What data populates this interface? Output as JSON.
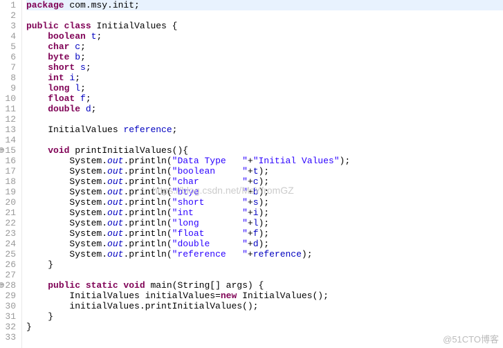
{
  "watermark_center": "https://blog.csdn.net/MsYfromGZ",
  "watermark_corner": "@51CTO博客",
  "code": {
    "lines": [
      {
        "n": 1,
        "marker": false,
        "hl": true,
        "tokens": [
          {
            "t": "kw",
            "v": "package"
          },
          {
            "t": "plain",
            "v": " com.msy.init;"
          }
        ]
      },
      {
        "n": 2,
        "marker": false,
        "tokens": []
      },
      {
        "n": 3,
        "marker": false,
        "tokens": [
          {
            "t": "kw",
            "v": "public class"
          },
          {
            "t": "plain",
            "v": " InitialValues {"
          }
        ]
      },
      {
        "n": 4,
        "marker": false,
        "tokens": [
          {
            "t": "plain",
            "v": "    "
          },
          {
            "t": "kw",
            "v": "boolean"
          },
          {
            "t": "plain",
            "v": " "
          },
          {
            "t": "fld",
            "v": "t"
          },
          {
            "t": "plain",
            "v": ";"
          }
        ]
      },
      {
        "n": 5,
        "marker": false,
        "tokens": [
          {
            "t": "plain",
            "v": "    "
          },
          {
            "t": "kw",
            "v": "char"
          },
          {
            "t": "plain",
            "v": " "
          },
          {
            "t": "fld",
            "v": "c"
          },
          {
            "t": "plain",
            "v": ";"
          }
        ]
      },
      {
        "n": 6,
        "marker": false,
        "tokens": [
          {
            "t": "plain",
            "v": "    "
          },
          {
            "t": "kw",
            "v": "byte"
          },
          {
            "t": "plain",
            "v": " "
          },
          {
            "t": "fld",
            "v": "b"
          },
          {
            "t": "plain",
            "v": ";"
          }
        ]
      },
      {
        "n": 7,
        "marker": false,
        "tokens": [
          {
            "t": "plain",
            "v": "    "
          },
          {
            "t": "kw",
            "v": "short"
          },
          {
            "t": "plain",
            "v": " "
          },
          {
            "t": "fld",
            "v": "s"
          },
          {
            "t": "plain",
            "v": ";"
          }
        ]
      },
      {
        "n": 8,
        "marker": false,
        "tokens": [
          {
            "t": "plain",
            "v": "    "
          },
          {
            "t": "kw",
            "v": "int"
          },
          {
            "t": "plain",
            "v": " "
          },
          {
            "t": "fld",
            "v": "i"
          },
          {
            "t": "plain",
            "v": ";"
          }
        ]
      },
      {
        "n": 9,
        "marker": false,
        "tokens": [
          {
            "t": "plain",
            "v": "    "
          },
          {
            "t": "kw",
            "v": "long"
          },
          {
            "t": "plain",
            "v": " "
          },
          {
            "t": "fld",
            "v": "l"
          },
          {
            "t": "plain",
            "v": ";"
          }
        ]
      },
      {
        "n": 10,
        "marker": false,
        "tokens": [
          {
            "t": "plain",
            "v": "    "
          },
          {
            "t": "kw",
            "v": "float"
          },
          {
            "t": "plain",
            "v": " "
          },
          {
            "t": "fld",
            "v": "f"
          },
          {
            "t": "plain",
            "v": ";"
          }
        ]
      },
      {
        "n": 11,
        "marker": false,
        "tokens": [
          {
            "t": "plain",
            "v": "    "
          },
          {
            "t": "kw",
            "v": "double"
          },
          {
            "t": "plain",
            "v": " "
          },
          {
            "t": "fld",
            "v": "d"
          },
          {
            "t": "plain",
            "v": ";"
          }
        ]
      },
      {
        "n": 12,
        "marker": false,
        "tokens": []
      },
      {
        "n": 13,
        "marker": false,
        "tokens": [
          {
            "t": "plain",
            "v": "    InitialValues "
          },
          {
            "t": "fld",
            "v": "reference"
          },
          {
            "t": "plain",
            "v": ";"
          }
        ]
      },
      {
        "n": 14,
        "marker": false,
        "tokens": []
      },
      {
        "n": 15,
        "marker": true,
        "tokens": [
          {
            "t": "plain",
            "v": "    "
          },
          {
            "t": "kw",
            "v": "void"
          },
          {
            "t": "plain",
            "v": " printInitialValues(){"
          }
        ]
      },
      {
        "n": 16,
        "marker": false,
        "tokens": [
          {
            "t": "plain",
            "v": "        System."
          },
          {
            "t": "stat",
            "v": "out"
          },
          {
            "t": "plain",
            "v": ".println("
          },
          {
            "t": "str",
            "v": "\"Data Type   \""
          },
          {
            "t": "plain",
            "v": "+"
          },
          {
            "t": "str",
            "v": "\"Initial Values\""
          },
          {
            "t": "plain",
            "v": ");"
          }
        ]
      },
      {
        "n": 17,
        "marker": false,
        "tokens": [
          {
            "t": "plain",
            "v": "        System."
          },
          {
            "t": "stat",
            "v": "out"
          },
          {
            "t": "plain",
            "v": ".println("
          },
          {
            "t": "str",
            "v": "\"boolean     \""
          },
          {
            "t": "plain",
            "v": "+"
          },
          {
            "t": "fld",
            "v": "t"
          },
          {
            "t": "plain",
            "v": ");"
          }
        ]
      },
      {
        "n": 18,
        "marker": false,
        "tokens": [
          {
            "t": "plain",
            "v": "        System."
          },
          {
            "t": "stat",
            "v": "out"
          },
          {
            "t": "plain",
            "v": ".println("
          },
          {
            "t": "str",
            "v": "\"char        \""
          },
          {
            "t": "plain",
            "v": "+"
          },
          {
            "t": "fld",
            "v": "c"
          },
          {
            "t": "plain",
            "v": ");"
          }
        ]
      },
      {
        "n": 19,
        "marker": false,
        "tokens": [
          {
            "t": "plain",
            "v": "        System."
          },
          {
            "t": "stat",
            "v": "out"
          },
          {
            "t": "plain",
            "v": ".println("
          },
          {
            "t": "str",
            "v": "\"btye        \""
          },
          {
            "t": "plain",
            "v": "+"
          },
          {
            "t": "fld",
            "v": "b"
          },
          {
            "t": "plain",
            "v": ");"
          }
        ]
      },
      {
        "n": 20,
        "marker": false,
        "tokens": [
          {
            "t": "plain",
            "v": "        System."
          },
          {
            "t": "stat",
            "v": "out"
          },
          {
            "t": "plain",
            "v": ".println("
          },
          {
            "t": "str",
            "v": "\"short       \""
          },
          {
            "t": "plain",
            "v": "+"
          },
          {
            "t": "fld",
            "v": "s"
          },
          {
            "t": "plain",
            "v": ");"
          }
        ]
      },
      {
        "n": 21,
        "marker": false,
        "tokens": [
          {
            "t": "plain",
            "v": "        System."
          },
          {
            "t": "stat",
            "v": "out"
          },
          {
            "t": "plain",
            "v": ".println("
          },
          {
            "t": "str",
            "v": "\"int         \""
          },
          {
            "t": "plain",
            "v": "+"
          },
          {
            "t": "fld",
            "v": "i"
          },
          {
            "t": "plain",
            "v": ");"
          }
        ]
      },
      {
        "n": 22,
        "marker": false,
        "tokens": [
          {
            "t": "plain",
            "v": "        System."
          },
          {
            "t": "stat",
            "v": "out"
          },
          {
            "t": "plain",
            "v": ".println("
          },
          {
            "t": "str",
            "v": "\"long        \""
          },
          {
            "t": "plain",
            "v": "+"
          },
          {
            "t": "fld",
            "v": "l"
          },
          {
            "t": "plain",
            "v": ");"
          }
        ]
      },
      {
        "n": 23,
        "marker": false,
        "tokens": [
          {
            "t": "plain",
            "v": "        System."
          },
          {
            "t": "stat",
            "v": "out"
          },
          {
            "t": "plain",
            "v": ".println("
          },
          {
            "t": "str",
            "v": "\"float       \""
          },
          {
            "t": "plain",
            "v": "+"
          },
          {
            "t": "fld",
            "v": "f"
          },
          {
            "t": "plain",
            "v": ");"
          }
        ]
      },
      {
        "n": 24,
        "marker": false,
        "tokens": [
          {
            "t": "plain",
            "v": "        System."
          },
          {
            "t": "stat",
            "v": "out"
          },
          {
            "t": "plain",
            "v": ".println("
          },
          {
            "t": "str",
            "v": "\"double      \""
          },
          {
            "t": "plain",
            "v": "+"
          },
          {
            "t": "fld",
            "v": "d"
          },
          {
            "t": "plain",
            "v": ");"
          }
        ]
      },
      {
        "n": 25,
        "marker": false,
        "tokens": [
          {
            "t": "plain",
            "v": "        System."
          },
          {
            "t": "stat",
            "v": "out"
          },
          {
            "t": "plain",
            "v": ".println("
          },
          {
            "t": "str",
            "v": "\"reference   \""
          },
          {
            "t": "plain",
            "v": "+"
          },
          {
            "t": "fld",
            "v": "reference"
          },
          {
            "t": "plain",
            "v": ");"
          }
        ]
      },
      {
        "n": 26,
        "marker": false,
        "tokens": [
          {
            "t": "plain",
            "v": "    }"
          }
        ]
      },
      {
        "n": 27,
        "marker": false,
        "tokens": []
      },
      {
        "n": 28,
        "marker": true,
        "tokens": [
          {
            "t": "plain",
            "v": "    "
          },
          {
            "t": "kw",
            "v": "public static void"
          },
          {
            "t": "plain",
            "v": " main(String[] args) {"
          }
        ]
      },
      {
        "n": 29,
        "marker": false,
        "tokens": [
          {
            "t": "plain",
            "v": "        InitialValues initialValues="
          },
          {
            "t": "kw",
            "v": "new"
          },
          {
            "t": "plain",
            "v": " InitialValues();"
          }
        ]
      },
      {
        "n": 30,
        "marker": false,
        "tokens": [
          {
            "t": "plain",
            "v": "        initialValues.printInitialValues();"
          }
        ]
      },
      {
        "n": 31,
        "marker": false,
        "tokens": [
          {
            "t": "plain",
            "v": "    }"
          }
        ]
      },
      {
        "n": 32,
        "marker": false,
        "tokens": [
          {
            "t": "plain",
            "v": "}"
          }
        ]
      },
      {
        "n": 33,
        "marker": false,
        "tokens": []
      }
    ]
  }
}
